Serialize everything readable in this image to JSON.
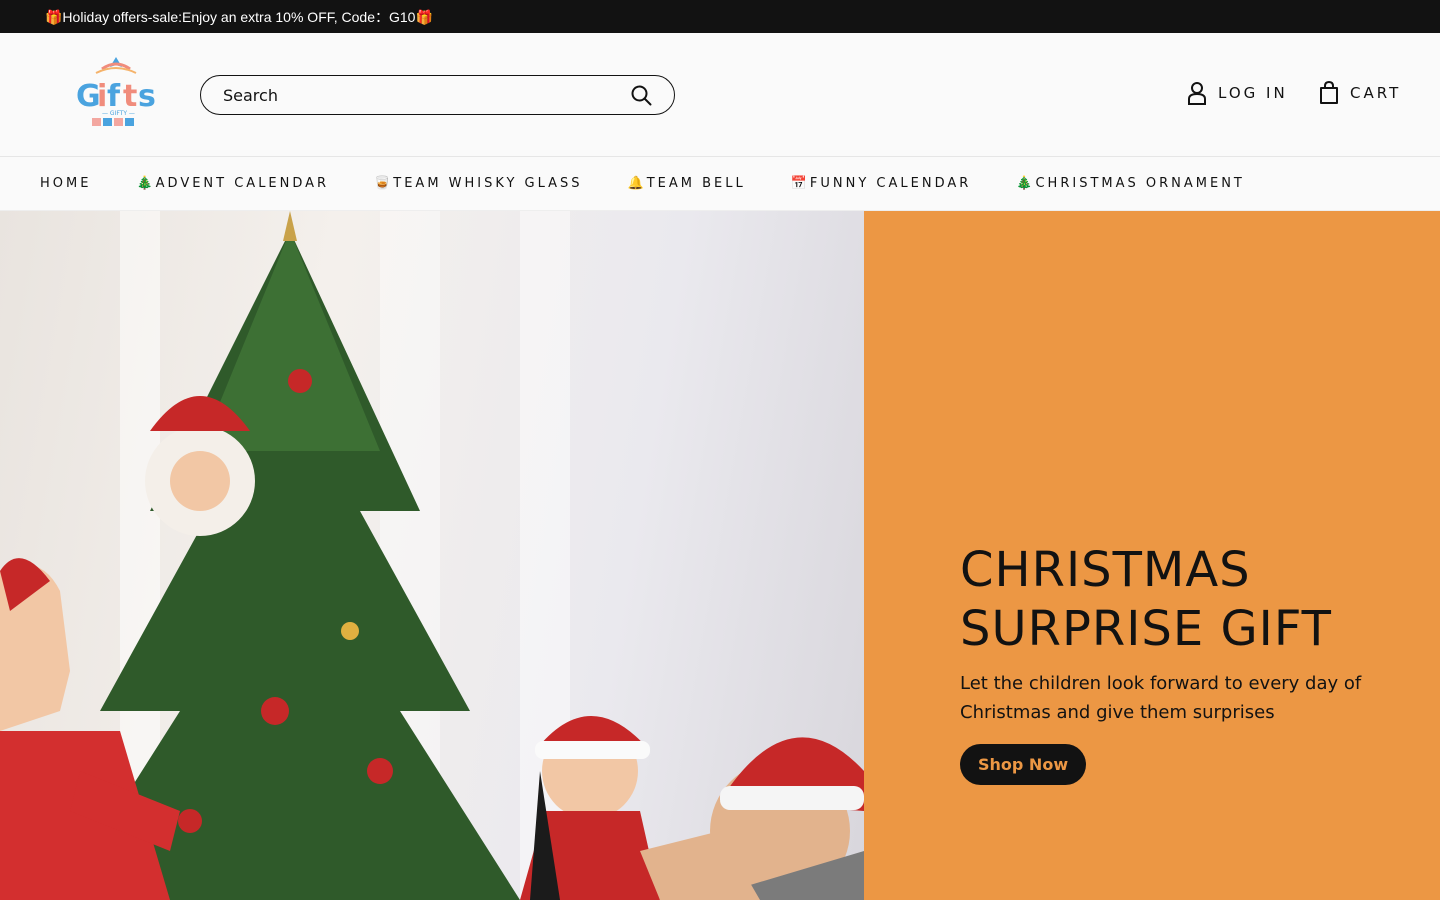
{
  "announcement": {
    "text": "🎁Holiday offers-sale:Enjoy an extra 10% OFF, Code：G10🎁"
  },
  "logo": {
    "word": "Gifts",
    "tagline": "GIFTY"
  },
  "search": {
    "placeholder": "Search"
  },
  "header": {
    "login_label": "LOG IN",
    "cart_label": "CART"
  },
  "nav": {
    "items": [
      {
        "label": "HOME"
      },
      {
        "label": "🎄ADVENT CALENDAR"
      },
      {
        "label": "🥃TEAM WHISKY GLASS"
      },
      {
        "label": "🔔TEAM BELL"
      },
      {
        "label": "📅FUNNY CALENDAR"
      },
      {
        "label": "🎄CHRISTMAS ORNAMENT"
      }
    ]
  },
  "hero": {
    "title_line1": "CHRISTMAS",
    "title_line2": "SURPRISE GIFT",
    "description": "Let the children look forward to every day of Christmas and give them surprises",
    "button_label": "Shop Now"
  },
  "colors": {
    "announcement_bg": "#121212",
    "hero_panel": "#ec9744",
    "button_text": "#ec9744"
  },
  "icons": [
    "search-icon",
    "user-icon",
    "shopping-bag-icon"
  ]
}
